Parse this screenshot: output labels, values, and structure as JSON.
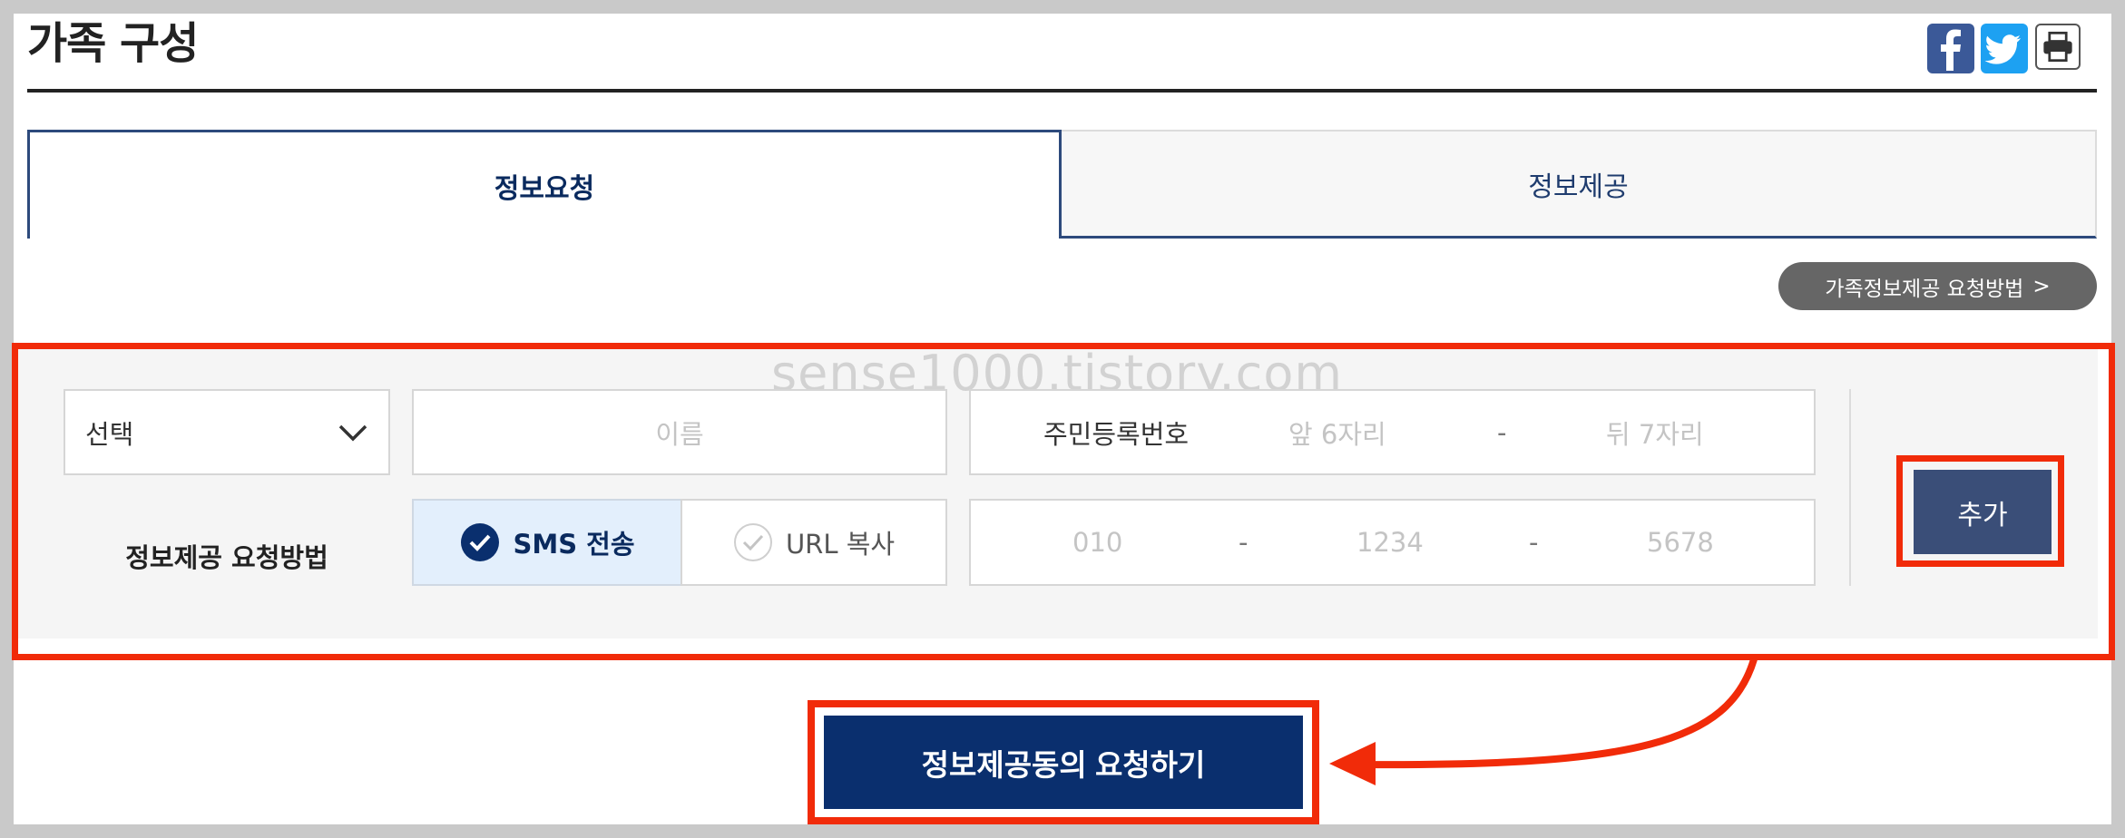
{
  "header": {
    "title": "가족 구성"
  },
  "tabs": [
    {
      "label": "정보요청",
      "active": true
    },
    {
      "label": "정보제공",
      "active": false
    }
  ],
  "guide_button": {
    "label": "가족정보제공 요청방법",
    "chevron": ">"
  },
  "form": {
    "relation_select": {
      "value": "선택"
    },
    "name_input": {
      "placeholder": "이름"
    },
    "rrn": {
      "label": "주민등록번호",
      "front_placeholder": "앞 6자리",
      "separator": "-",
      "back_placeholder": "뒤 7자리"
    },
    "method": {
      "label": "정보제공 요청방법",
      "options": [
        {
          "label": "SMS 전송",
          "selected": true
        },
        {
          "label": "URL 복사",
          "selected": false
        }
      ]
    },
    "phone": {
      "part1": "010",
      "part2": "1234",
      "part3": "5678",
      "separator": "-"
    },
    "add_button": {
      "label": "추가"
    }
  },
  "submit_button": {
    "label": "정보제공동의 요청하기"
  },
  "watermark": "sense1000.tistory.com",
  "colors": {
    "annotation_red": "#f12b09",
    "primary_navy": "#0a2f6e",
    "add_button": "#3a4e78",
    "sms_selected_bg": "#e3effc",
    "facebook": "#3b5998",
    "twitter": "#1da1f2"
  },
  "icons": [
    "facebook-icon",
    "twitter-icon",
    "print-icon",
    "chevron-down-icon",
    "check-circle-icon"
  ]
}
